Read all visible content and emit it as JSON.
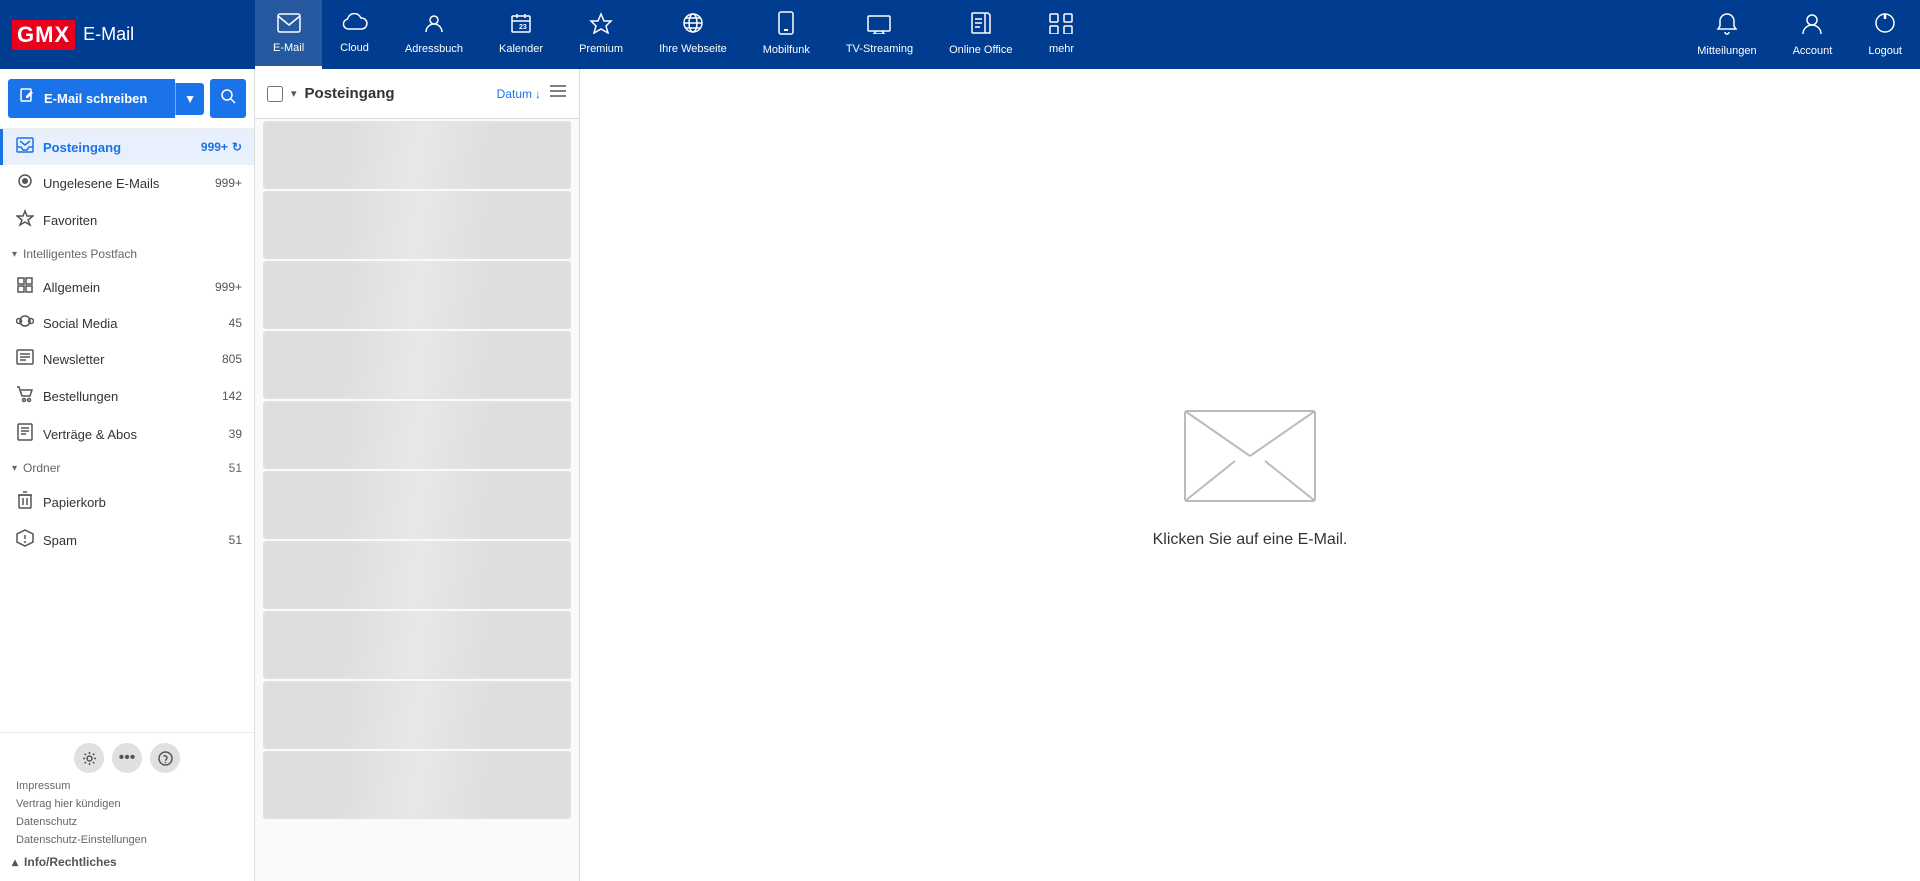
{
  "logo": {
    "gmx": "GMX",
    "email": "E-Mail"
  },
  "nav": {
    "items": [
      {
        "id": "email",
        "label": "E-Mail",
        "icon": "✉",
        "active": true
      },
      {
        "id": "cloud",
        "label": "Cloud",
        "icon": "☁"
      },
      {
        "id": "adressbuch",
        "label": "Adressbuch",
        "icon": "👤"
      },
      {
        "id": "kalender",
        "label": "Kalender",
        "icon": "📅"
      },
      {
        "id": "premium",
        "label": "Premium",
        "icon": "★"
      },
      {
        "id": "webseite",
        "label": "Ihre Webseite",
        "icon": "🌐"
      },
      {
        "id": "mobilfunk",
        "label": "Mobilfunk",
        "icon": "📱"
      },
      {
        "id": "tv",
        "label": "TV-Streaming",
        "icon": "📺"
      },
      {
        "id": "office",
        "label": "Online Office",
        "icon": "📄"
      },
      {
        "id": "mehr",
        "label": "mehr",
        "icon": "⋯"
      }
    ],
    "right": [
      {
        "id": "mitteilungen",
        "label": "Mitteilungen",
        "icon": "🔔"
      },
      {
        "id": "account",
        "label": "Account",
        "icon": "👤"
      },
      {
        "id": "logout",
        "label": "Logout",
        "icon": "⏻"
      }
    ]
  },
  "compose": {
    "label": "E-Mail schreiben",
    "dropdown_icon": "▼",
    "search_icon": "🔍"
  },
  "sidebar": {
    "items": [
      {
        "id": "posteingang",
        "label": "Posteingang",
        "icon": "inbox",
        "count": "999+",
        "active": true
      },
      {
        "id": "ungelesen",
        "label": "Ungelesene E-Mails",
        "icon": "circle",
        "count": "999+",
        "active": false
      },
      {
        "id": "favoriten",
        "label": "Favoriten",
        "icon": "star",
        "count": "",
        "active": false
      }
    ],
    "smart_section": {
      "label": "Intelligentes Postfach",
      "collapsed": false
    },
    "smart_items": [
      {
        "id": "allgemein",
        "label": "Allgemein",
        "icon": "grid",
        "count": "999+"
      },
      {
        "id": "social",
        "label": "Social Media",
        "icon": "social",
        "count": "45"
      },
      {
        "id": "newsletter",
        "label": "Newsletter",
        "icon": "newsletter",
        "count": "805"
      },
      {
        "id": "bestellungen",
        "label": "Bestellungen",
        "icon": "cart",
        "count": "142"
      },
      {
        "id": "vertraege",
        "label": "Verträge & Abos",
        "icon": "contract",
        "count": "39"
      }
    ],
    "folder_section": {
      "label": "Ordner",
      "count": "51",
      "collapsed": false
    },
    "folder_items": [
      {
        "id": "papierkorb",
        "label": "Papierkorb",
        "icon": "trash",
        "count": ""
      },
      {
        "id": "spam",
        "label": "Spam",
        "icon": "spam",
        "count": "51"
      }
    ],
    "footer_links": [
      {
        "id": "impressum",
        "label": "Impressum"
      },
      {
        "id": "kuendigen",
        "label": "Vertrag hier kündigen"
      },
      {
        "id": "datenschutz",
        "label": "Datenschutz"
      },
      {
        "id": "datenschutz-einstellungen",
        "label": "Datenschutz-Einstellungen"
      }
    ],
    "info_section": {
      "label": "Info/Rechtliches",
      "expanded": true
    }
  },
  "email_list": {
    "title": "Posteingang",
    "sort_label": "Datum",
    "sort_icon": "↓"
  },
  "empty_state": {
    "message": "Klicken Sie auf eine E-Mail."
  }
}
